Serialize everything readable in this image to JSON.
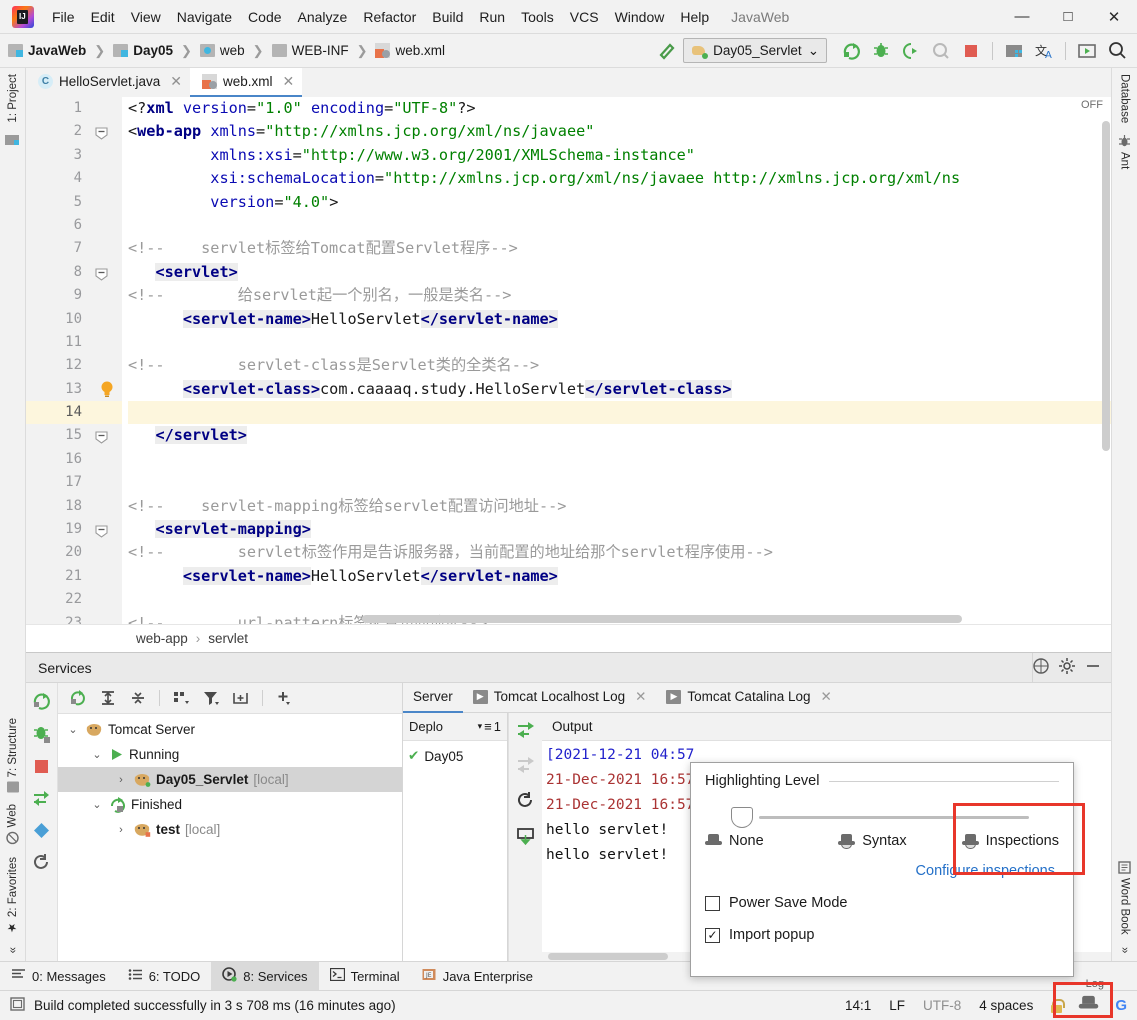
{
  "window": {
    "project_name": "JavaWeb",
    "minimize": "—",
    "maximize": "□",
    "close": "✕"
  },
  "menubar": {
    "items": [
      "File",
      "Edit",
      "View",
      "Navigate",
      "Code",
      "Analyze",
      "Refactor",
      "Build",
      "Run",
      "Tools",
      "VCS",
      "Window",
      "Help"
    ]
  },
  "breadcrumb": {
    "items": [
      "JavaWeb",
      "Day05",
      "web",
      "WEB-INF",
      "web.xml"
    ],
    "separator": "❯"
  },
  "toolbar": {
    "run_config": "Day05_Servlet",
    "dropdown_caret": "⌄"
  },
  "editor_tabs": [
    {
      "label": "HelloServlet.java",
      "icon": "java-class-icon",
      "active": false,
      "close": "✕"
    },
    {
      "label": "web.xml",
      "icon": "xml-file-icon",
      "active": true,
      "close": "✕"
    }
  ],
  "editor": {
    "off_label": "OFF",
    "lines": [
      {
        "n": "1",
        "tokens": [
          {
            "t": "punc",
            "s": "<?"
          },
          {
            "t": "kw",
            "s": "xml"
          },
          {
            "t": "sp",
            "s": " "
          },
          {
            "t": "attr",
            "s": "version"
          },
          {
            "t": "punc",
            "s": "="
          },
          {
            "t": "val",
            "s": "\"1.0\""
          },
          {
            "t": "sp",
            "s": " "
          },
          {
            "t": "attr",
            "s": "encoding"
          },
          {
            "t": "punc",
            "s": "="
          },
          {
            "t": "val",
            "s": "\"UTF-8\""
          },
          {
            "t": "punc",
            "s": "?>"
          }
        ]
      },
      {
        "n": "2",
        "fold": "collapse",
        "tokens": [
          {
            "t": "punc",
            "s": "<"
          },
          {
            "t": "kw",
            "s": "web-app"
          },
          {
            "t": "sp",
            "s": " "
          },
          {
            "t": "attr",
            "s": "xmlns"
          },
          {
            "t": "punc",
            "s": "="
          },
          {
            "t": "val",
            "s": "\"http://xmlns.jcp.org/xml/ns/javaee\""
          }
        ]
      },
      {
        "n": "3",
        "tokens": [
          {
            "t": "sp",
            "s": "         "
          },
          {
            "t": "attr",
            "s": "xmlns:xsi"
          },
          {
            "t": "punc",
            "s": "="
          },
          {
            "t": "val",
            "s": "\"http://www.w3.org/2001/XMLSchema-instance\""
          }
        ]
      },
      {
        "n": "4",
        "tokens": [
          {
            "t": "sp",
            "s": "         "
          },
          {
            "t": "attr",
            "s": "xsi:schemaLocation"
          },
          {
            "t": "punc",
            "s": "="
          },
          {
            "t": "val",
            "s": "\"http://xmlns.jcp.org/xml/ns/javaee http://xmlns.jcp.org/xml/ns"
          }
        ]
      },
      {
        "n": "5",
        "tokens": [
          {
            "t": "sp",
            "s": "         "
          },
          {
            "t": "attr",
            "s": "version"
          },
          {
            "t": "punc",
            "s": "="
          },
          {
            "t": "val",
            "s": "\"4.0\""
          },
          {
            "t": "punc",
            "s": ">"
          }
        ]
      },
      {
        "n": "6",
        "tokens": []
      },
      {
        "n": "7",
        "tokens": [
          {
            "t": "cmt",
            "s": "<!--    servlet标签给Tomcat配置Servlet程序-->"
          }
        ]
      },
      {
        "n": "8",
        "fold": "collapse",
        "tokens": [
          {
            "t": "sp",
            "s": "   "
          },
          {
            "t": "tag",
            "s": "<servlet>"
          }
        ]
      },
      {
        "n": "9",
        "tokens": [
          {
            "t": "cmt",
            "s": "<!--        给servlet起一个别名，一般是类名-->"
          }
        ]
      },
      {
        "n": "10",
        "tokens": [
          {
            "t": "sp",
            "s": "      "
          },
          {
            "t": "tag",
            "s": "<servlet-name>"
          },
          {
            "t": "text",
            "s": "HelloServlet"
          },
          {
            "t": "tag",
            "s": "</servlet-name>"
          }
        ]
      },
      {
        "n": "11",
        "tokens": []
      },
      {
        "n": "12",
        "tokens": [
          {
            "t": "cmt",
            "s": "<!--        servlet-class是Servlet类的全类名-->"
          }
        ]
      },
      {
        "n": "13",
        "bulb": true,
        "tokens": [
          {
            "t": "sp",
            "s": "      "
          },
          {
            "t": "tag",
            "s": "<servlet-class>"
          },
          {
            "t": "text",
            "s": "com.caaaaq.study.HelloServlet"
          },
          {
            "t": "tag",
            "s": "</servlet-class>"
          }
        ]
      },
      {
        "n": "14",
        "highlight": true,
        "tokens": []
      },
      {
        "n": "15",
        "fold": "end",
        "tokens": [
          {
            "t": "sp",
            "s": "   "
          },
          {
            "t": "tag",
            "s": "</servlet>"
          }
        ]
      },
      {
        "n": "16",
        "tokens": []
      },
      {
        "n": "17",
        "tokens": []
      },
      {
        "n": "18",
        "tokens": [
          {
            "t": "cmt",
            "s": "<!--    servlet-mapping标签给servlet配置访问地址-->"
          }
        ]
      },
      {
        "n": "19",
        "fold": "collapse",
        "tokens": [
          {
            "t": "sp",
            "s": "   "
          },
          {
            "t": "tag",
            "s": "<servlet-mapping>"
          }
        ]
      },
      {
        "n": "20",
        "tokens": [
          {
            "t": "cmt",
            "s": "<!--        servlet标签作用是告诉服务器，当前配置的地址给那个servlet程序使用-->"
          }
        ]
      },
      {
        "n": "21",
        "tokens": [
          {
            "t": "sp",
            "s": "      "
          },
          {
            "t": "tag",
            "s": "<servlet-name>"
          },
          {
            "t": "text",
            "s": "HelloServlet"
          },
          {
            "t": "tag",
            "s": "</servlet-name>"
          }
        ]
      },
      {
        "n": "22",
        "tokens": []
      },
      {
        "n": "23",
        "tokens": [
          {
            "t": "cmt",
            "s": "<!--        url-pattern标签配置访问地址-->"
          }
        ]
      },
      {
        "n": "24",
        "tokens": []
      }
    ],
    "bottom_breadcrumb": [
      "web-app",
      "servlet"
    ],
    "bottom_breadcrumb_sep": "›"
  },
  "left_strip": {
    "top": [
      {
        "label": "1: Project",
        "icon": "project-folder-icon"
      }
    ],
    "bottom": [
      {
        "label": "7: Structure",
        "icon": "structure-icon"
      },
      {
        "label": "Web",
        "icon": "web-globe-icon"
      },
      {
        "label": "2: Favorites",
        "icon": "star-icon"
      },
      {
        "label": "»",
        "icon": "more-icon"
      }
    ]
  },
  "right_strip": {
    "top": [
      {
        "label": "Database",
        "icon": "database-icon"
      },
      {
        "label": "Ant",
        "icon": "ant-bug-icon"
      }
    ],
    "bottom": [
      {
        "label": "Word Book",
        "icon": "word-book-icon"
      },
      {
        "label": "»",
        "icon": "more-icon"
      }
    ]
  },
  "services": {
    "title": "Services",
    "tree": [
      {
        "depth": 0,
        "label": "Tomcat Server",
        "chevron": "⌄",
        "icon": "tomcat-icon",
        "bold": false,
        "suffix": "",
        "selected": false
      },
      {
        "depth": 1,
        "label": "Running",
        "chevron": "⌄",
        "icon": "run-icon",
        "bold": false,
        "suffix": "",
        "selected": false
      },
      {
        "depth": 2,
        "label": "Day05_Servlet",
        "chevron": "›",
        "icon": "tomcat-running-icon",
        "bold": true,
        "suffix": "[local]",
        "selected": true
      },
      {
        "depth": 1,
        "label": "Finished",
        "chevron": "⌄",
        "icon": "rerun-icon",
        "bold": false,
        "suffix": "",
        "selected": false
      },
      {
        "depth": 2,
        "label": "test",
        "chevron": "›",
        "icon": "tomcat-stopped-icon",
        "bold": true,
        "suffix": "[local]",
        "selected": false
      }
    ],
    "console_tabs": [
      {
        "label": "Server",
        "active": true,
        "closable": false
      },
      {
        "label": "Tomcat Localhost Log",
        "active": false,
        "closable": true,
        "close": "✕"
      },
      {
        "label": "Tomcat Catalina Log",
        "active": false,
        "closable": true,
        "close": "✕"
      }
    ],
    "deploy_header": "Deplo",
    "deploy_count": "1",
    "deploy_items": [
      {
        "label": "Day05",
        "status": "✔"
      }
    ],
    "output_header": "Output",
    "output_lines": [
      {
        "color": "blue",
        "text": "[2021-12-21 04:57"
      },
      {
        "color": "red",
        "text": "21-Dec-2021 16:57"
      },
      {
        "color": "red",
        "text": "21-Dec-2021 16:57"
      },
      {
        "color": "black",
        "text": "hello servlet!"
      },
      {
        "color": "black",
        "text": "hello servlet!"
      }
    ]
  },
  "highlighting_popup": {
    "title": "Highlighting Level",
    "levels": [
      "None",
      "Syntax",
      "Inspections"
    ],
    "selected_level": "None",
    "configure_link": "Configure inspections",
    "power_save_mode": {
      "label": "Power Save Mode",
      "checked": false,
      "mark": ""
    },
    "import_popup": {
      "label": "Import popup",
      "checked": true,
      "mark": "✓"
    }
  },
  "bottom_tabs": [
    {
      "label": "0: Messages",
      "icon": "messages-icon",
      "active": false
    },
    {
      "label": "6: TODO",
      "icon": "todo-icon",
      "active": false
    },
    {
      "label": "8: Services",
      "icon": "services-icon",
      "active": true
    },
    {
      "label": "Terminal",
      "icon": "terminal-icon",
      "active": false
    },
    {
      "label": "Java Enterprise",
      "icon": "java-enterprise-icon",
      "active": false
    }
  ],
  "statusbar": {
    "message": "Build completed successfully in 3 s 708 ms (16 minutes ago)",
    "caret": "14:1",
    "line_sep": "LF",
    "encoding": "UTF-8",
    "indent": "4 spaces",
    "log_label": "Log"
  }
}
